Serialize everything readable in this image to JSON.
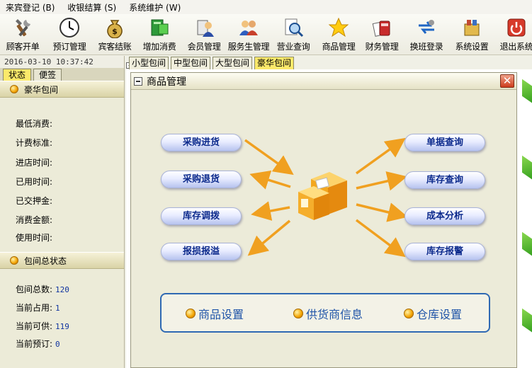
{
  "menu": [
    "来宾登记 (B)",
    "收银结算 (S)",
    "系统维护 (W)"
  ],
  "toolbar": [
    {
      "label": "顾客开单",
      "icon": "tools-icon"
    },
    {
      "label": "预订管理",
      "icon": "clock-icon"
    },
    {
      "label": "宾客结账",
      "icon": "money-bag-icon"
    },
    {
      "label": "增加消费",
      "icon": "add-consumption-icon"
    },
    {
      "label": "会员管理",
      "icon": "member-icon"
    },
    {
      "label": "服务生管理",
      "icon": "staff-icon"
    },
    {
      "label": "营业查询",
      "icon": "search-icon"
    },
    {
      "label": "商品管理",
      "icon": "star-icon"
    },
    {
      "label": "财务管理",
      "icon": "finance-icon"
    },
    {
      "label": "换班登录",
      "icon": "shift-icon"
    },
    {
      "label": "系统设置",
      "icon": "settings-icon"
    },
    {
      "label": "退出系统",
      "icon": "power-icon"
    }
  ],
  "left": {
    "datetime": "2016-03-10 10:37:42",
    "tabs": [
      "状态",
      "便签"
    ],
    "room_section": {
      "title": "豪华包间",
      "fields": [
        "最低消费:",
        "计费标准:",
        "进店时间:",
        "已用时间:",
        "已交押金:",
        "消费金额:",
        "使用时间:"
      ]
    },
    "status_section": {
      "title": "包间总状态",
      "fields": [
        {
          "label": "包间总数:",
          "value": "120"
        },
        {
          "label": "当前占用:",
          "value": "1"
        },
        {
          "label": "当前可供:",
          "value": "119"
        },
        {
          "label": "当前预订:",
          "value": "0"
        }
      ]
    }
  },
  "room_tabs": [
    "小型包间",
    "中型包间",
    "大型包间",
    "豪华包间"
  ],
  "dialog": {
    "title": "商品管理",
    "left_buttons": [
      "采购进货",
      "采购退货",
      "库存调拨",
      "报损报溢"
    ],
    "right_buttons": [
      "单据查询",
      "库存查询",
      "成本分析",
      "库存报警"
    ],
    "bottom_links": [
      "商品设置",
      "供货商信息",
      "仓库设置"
    ]
  },
  "colors": {
    "pill_text": "#0c2a8c",
    "link_text": "#1f54a8",
    "arrow": "#f0a020"
  }
}
